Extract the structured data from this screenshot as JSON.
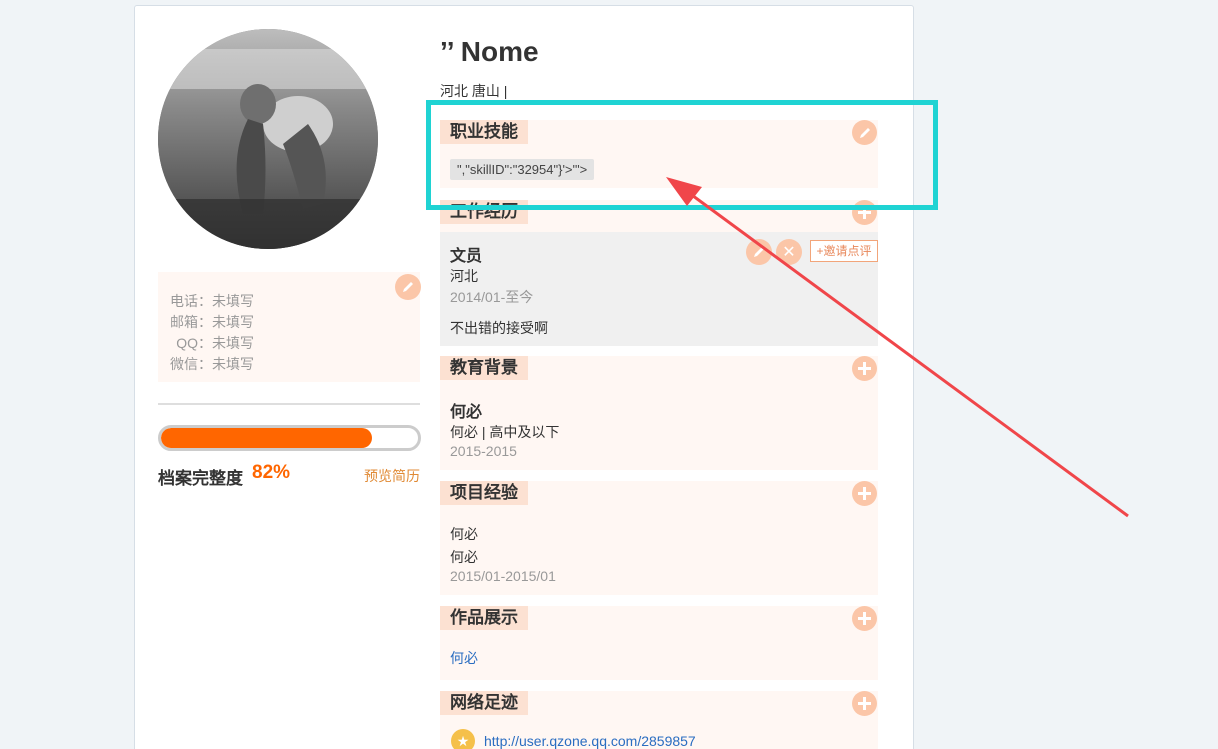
{
  "profile": {
    "name": "’’ Nome",
    "location": "河北   唐山  |"
  },
  "contact": {
    "rows": [
      {
        "label": "电话：",
        "value": "未填写"
      },
      {
        "label": "邮箱：",
        "value": "未填写"
      },
      {
        "label": "QQ：",
        "value": "未填写"
      },
      {
        "label": "微信：",
        "value": "未填写"
      }
    ]
  },
  "completion": {
    "label": "档案完整度",
    "percent_text": "82%",
    "percent": 82,
    "preview_link": "预览简历"
  },
  "sections": {
    "skills": {
      "title": "职业技能",
      "tag": "\",\"skillID\":\"32954\"}'>'\">"
    },
    "work": {
      "title": "工作经历",
      "position": "文员",
      "city": "河北",
      "period": "2014/01-至今",
      "description": "不出错的接受啊",
      "invite_button": "+邀请点评"
    },
    "education": {
      "title": "教育背景",
      "school": "何必",
      "detail": "何必  |  高中及以下",
      "period": "2015-2015"
    },
    "projects": {
      "title": "项目经验",
      "name": "何必",
      "role": "何必",
      "period": "2015/01-2015/01"
    },
    "works": {
      "title": "作品展示",
      "link": "何必"
    },
    "footprint": {
      "title": "网络足迹",
      "url": "http://user.qzone.qq.com/2859857"
    }
  },
  "colors": {
    "accent": "#ff6600",
    "highlight_box": "#1fd3d3",
    "arrow": "#f0464a",
    "section_bg": "#fff7f3",
    "button_bg": "#fbc6a8"
  },
  "icons": [
    "pencil-icon",
    "plus-icon",
    "close-icon",
    "star-icon"
  ]
}
